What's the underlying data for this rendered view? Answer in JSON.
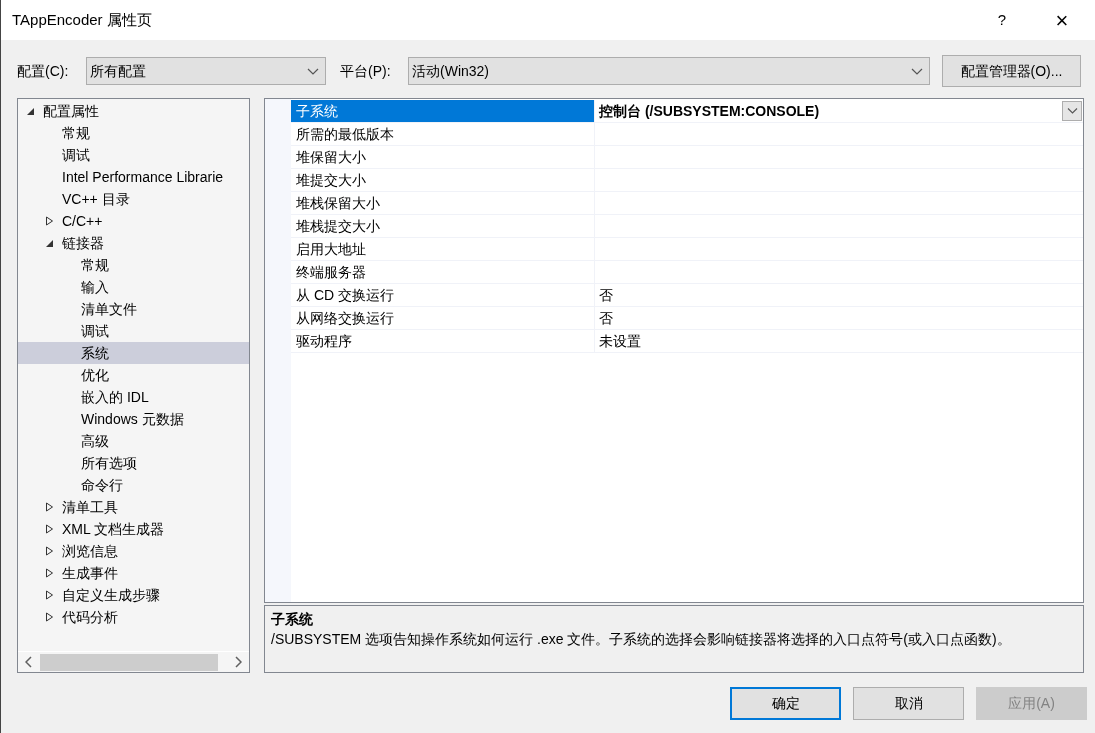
{
  "window": {
    "title": "TAppEncoder 属性页",
    "help": "?",
    "close": "×"
  },
  "toolbar": {
    "config_label": "配置(C):",
    "config_value": "所有配置",
    "platform_label": "平台(P):",
    "platform_value": "活动(Win32)",
    "manager_button": "配置管理器(O)..."
  },
  "tree": [
    {
      "label": "配置属性",
      "expanded": true,
      "selected": false,
      "children": [
        {
          "label": "常规",
          "selected": false
        },
        {
          "label": "调试",
          "selected": false
        },
        {
          "label": "Intel Performance Librarie",
          "selected": false
        },
        {
          "label": "VC++ 目录",
          "selected": false
        },
        {
          "label": "C/C++",
          "expanded": false,
          "selected": false
        },
        {
          "label": "链接器",
          "expanded": true,
          "selected": false,
          "children": [
            {
              "label": "常规",
              "selected": false
            },
            {
              "label": "输入",
              "selected": false
            },
            {
              "label": "清单文件",
              "selected": false
            },
            {
              "label": "调试",
              "selected": false
            },
            {
              "label": "系统",
              "selected": true
            },
            {
              "label": "优化",
              "selected": false
            },
            {
              "label": "嵌入的 IDL",
              "selected": false
            },
            {
              "label": "Windows 元数据",
              "selected": false
            },
            {
              "label": "高级",
              "selected": false
            },
            {
              "label": "所有选项",
              "selected": false
            },
            {
              "label": "命令行",
              "selected": false
            }
          ]
        },
        {
          "label": "清单工具",
          "expanded": false,
          "selected": false
        },
        {
          "label": "XML 文档生成器",
          "expanded": false,
          "selected": false
        },
        {
          "label": "浏览信息",
          "expanded": false,
          "selected": false
        },
        {
          "label": "生成事件",
          "expanded": false,
          "selected": false
        },
        {
          "label": "自定义生成步骤",
          "expanded": false,
          "selected": false
        },
        {
          "label": "代码分析",
          "expanded": false,
          "selected": false
        }
      ]
    }
  ],
  "properties": [
    {
      "name": "子系统",
      "value": "控制台 (/SUBSYSTEM:CONSOLE)",
      "modified": true,
      "selected": true
    },
    {
      "name": "所需的最低版本",
      "selected": false
    },
    {
      "name": "堆保留大小",
      "selected": false
    },
    {
      "name": "堆提交大小",
      "selected": false
    },
    {
      "name": "堆栈保留大小",
      "selected": false
    },
    {
      "name": "堆栈提交大小",
      "selected": false
    },
    {
      "name": "启用大地址",
      "selected": false
    },
    {
      "name": "终端服务器",
      "selected": false
    },
    {
      "name": "从 CD 交换运行",
      "value": "否",
      "modified": false,
      "selected": false
    },
    {
      "name": "从网络交换运行",
      "value": "否",
      "modified": false,
      "selected": false
    },
    {
      "name": "驱动程序",
      "value": "未设置",
      "modified": false,
      "selected": false
    }
  ],
  "description": {
    "title": "子系统",
    "text": "/SUBSYSTEM 选项告知操作系统如何运行 .exe 文件。子系统的选择会影响链接器将选择的入口点符号(或入口点函数)。"
  },
  "buttons": [
    {
      "label": "确定",
      "kind": "default",
      "disabled": false
    },
    {
      "label": "取消",
      "kind": "normal",
      "disabled": false
    },
    {
      "label": "应用(A)",
      "kind": "normal",
      "disabled": true
    }
  ]
}
